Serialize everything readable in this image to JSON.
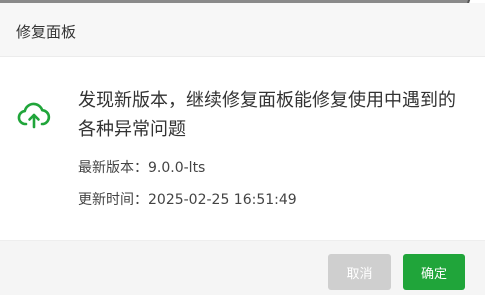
{
  "dialog": {
    "title": "修复面板",
    "message": "发现新版本，继续修复面板能修复使用中遇到的各种异常问题",
    "version_label": "最新版本：",
    "version_value": "9.0.0-lts",
    "time_label": "更新时间：",
    "time_value": "2025-02-25 16:51:49",
    "cancel_label": "取消",
    "confirm_label": "确定"
  },
  "colors": {
    "accent": "#20a53a",
    "cancel_bg": "#cfcfcf"
  },
  "icons": {
    "status": "cloud-upload-icon"
  }
}
